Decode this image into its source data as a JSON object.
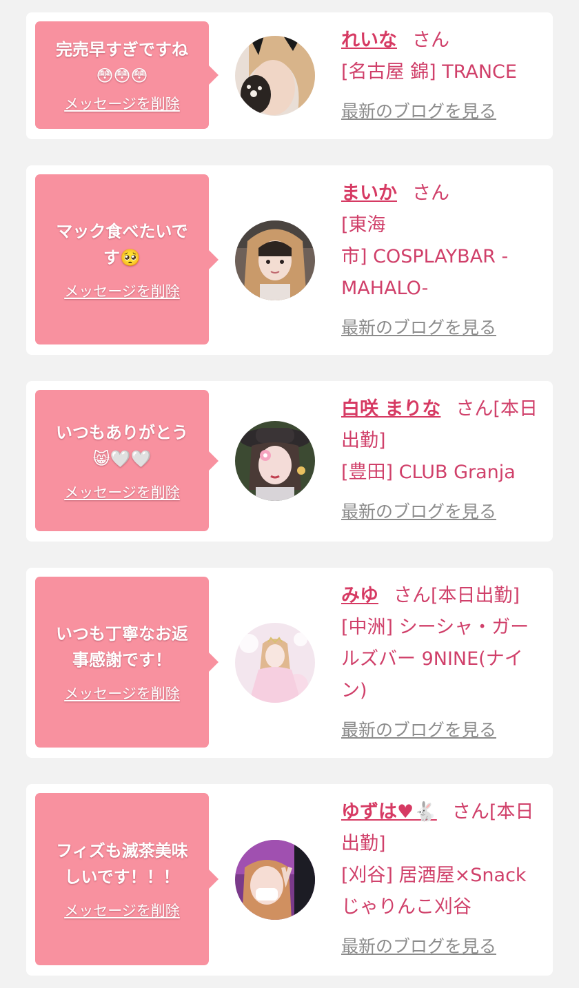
{
  "theme": {
    "background": "#f2f2f2",
    "card": "#ffffff",
    "bubble": "#f8919f",
    "accent": "#d63a63",
    "muted": "#8c8c8c"
  },
  "cards": [
    {
      "message": "完売早すぎですね\n😳😳😳",
      "delete_label": "メッセージを削除",
      "name": "れいな",
      "honorific": "さん",
      "shop": "[名古屋 錦] TRANCE",
      "blog_label": "最新のブログを見る"
    },
    {
      "message": "マック食べたいで\nす🥺",
      "delete_label": "メッセージを削除",
      "name": "まいか",
      "honorific": "さん",
      "shop": "[東海\n市] COSPLAYBAR -\nMAHALO-",
      "blog_label": "最新のブログを見る"
    },
    {
      "message": "いつもありがとう\n😸🤍🤍",
      "delete_label": "メッセージを削除",
      "name": "白咲 まりな",
      "honorific": "さん[本日出勤]",
      "shop": "[豊田] CLUB Granja",
      "blog_label": "最新のブログを見る"
    },
    {
      "message": "いつも丁寧なお返\n事感謝です！",
      "delete_label": "メッセージを削除",
      "name": "みゆ",
      "honorific": "さん[本日出勤]",
      "shop": "[中洲] シーシャ・ガールズバー 9NINE(ナイン)",
      "blog_label": "最新のブログを見る"
    },
    {
      "message": "フィズも滅茶美味\nしいです！！！",
      "delete_label": "メッセージを削除",
      "name": "ゆずは♥🐇",
      "honorific": "さん[本日出勤]",
      "shop": "[刈谷] 居酒屋×Snack じゃりんこ刈谷",
      "blog_label": "最新のブログを見る"
    }
  ]
}
